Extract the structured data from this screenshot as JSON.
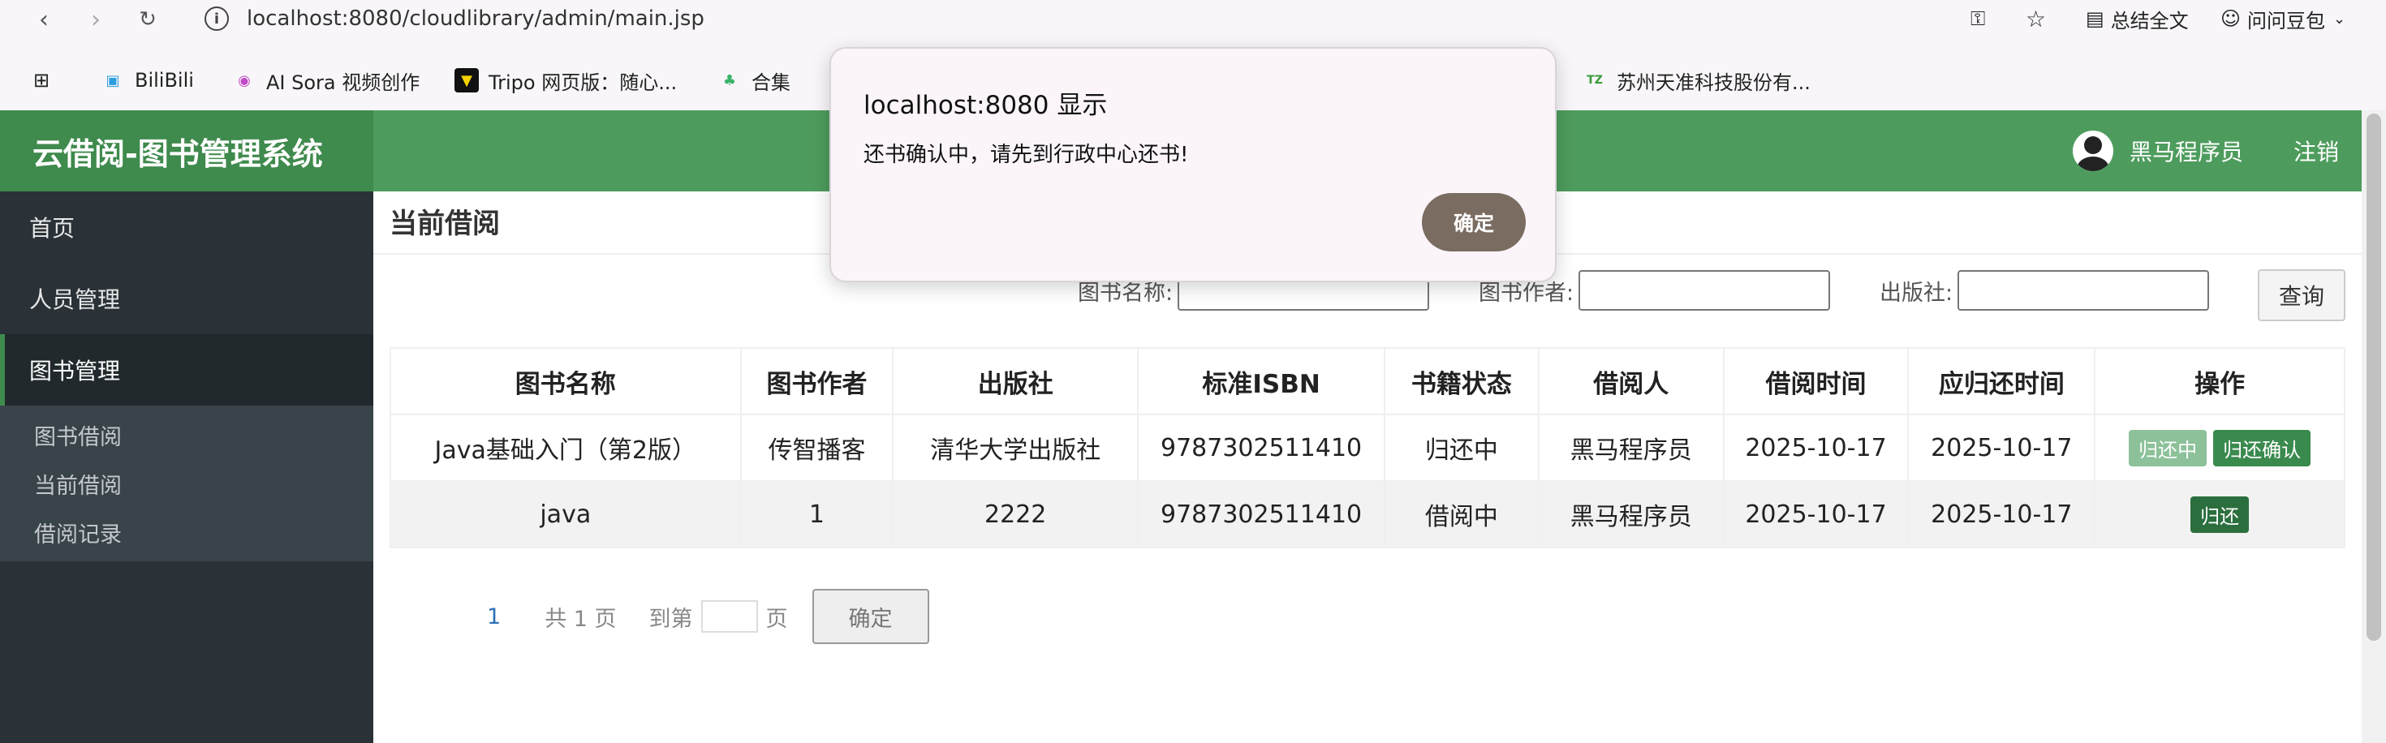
{
  "browser": {
    "url": "localhost:8080/cloudlibrary/admin/main.jsp",
    "summary_label": "总结全文",
    "doubao_label": "问问豆包"
  },
  "bookmarks": [
    {
      "label": "BiliBili"
    },
    {
      "label": "AI Sora 视频创作"
    },
    {
      "label": "Tripo 网页版：随心..."
    },
    {
      "label": "合集"
    },
    {
      "label": "苏州天准科技股份有..."
    }
  ],
  "header": {
    "app_title": "云借阅-图书管理系统",
    "username": "黑马程序员",
    "logout": "注销",
    "accent": "#4e9c5d"
  },
  "sidebar": {
    "items": [
      {
        "label": "首页"
      },
      {
        "label": "人员管理"
      },
      {
        "label": "图书管理"
      }
    ],
    "sub_items": [
      {
        "label": "图书借阅"
      },
      {
        "label": "当前借阅"
      },
      {
        "label": "借阅记录"
      }
    ]
  },
  "main": {
    "title": "当前借阅",
    "search": {
      "name_label": "图书名称:",
      "author_label": "图书作者:",
      "press_label": "出版社:",
      "query_button": "查询"
    },
    "table": {
      "headers": [
        "图书名称",
        "图书作者",
        "出版社",
        "标准ISBN",
        "书籍状态",
        "借阅人",
        "借阅时间",
        "应归还时间",
        "操作"
      ],
      "rows": [
        {
          "cells": [
            "Java基础入门（第2版）",
            "传智播客",
            "清华大学出版社",
            "9787302511410",
            "归还中",
            "黑马程序员",
            "2025-10-17",
            "2025-10-17"
          ],
          "actions": [
            "归还中",
            "归还确认"
          ]
        },
        {
          "cells": [
            "java",
            "1",
            "2222",
            "9787302511410",
            "借阅中",
            "黑马程序员",
            "2025-10-17",
            "2025-10-17"
          ],
          "actions": [
            "归还"
          ]
        }
      ]
    },
    "pager": {
      "current_page": "1",
      "total": "共 1 页",
      "goto_prefix": "到第",
      "goto_suffix": "页",
      "confirm": "确定"
    }
  },
  "dialog": {
    "title": "localhost:8080 显示",
    "message": "还书确认中，请先到行政中心还书!",
    "ok": "确定"
  }
}
